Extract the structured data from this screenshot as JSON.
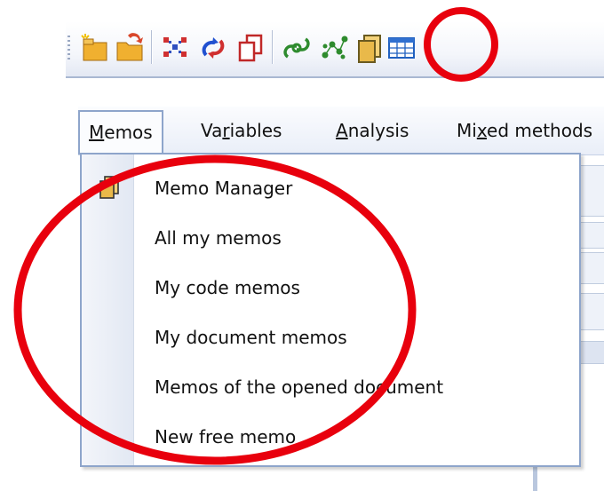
{
  "toolbar": {
    "buttons": [
      {
        "name": "new-project-icon",
        "color": "#e0a22a"
      },
      {
        "name": "open-project-icon",
        "color": "#d9472b"
      },
      {
        "name": "code-relations-icon",
        "color": "#d03030"
      },
      {
        "name": "activate-icon",
        "color": "#2050d0"
      },
      {
        "name": "copy-icon",
        "color": "#c02828"
      },
      {
        "name": "link-icon",
        "color": "#2e8b2e"
      },
      {
        "name": "graph-icon",
        "color": "#2e8b2e"
      },
      {
        "name": "memo-manager-icon",
        "color": "#e0b84a",
        "highlighted": true
      },
      {
        "name": "table-icon",
        "color": "#2060c0"
      }
    ]
  },
  "menubar": {
    "items": [
      {
        "label_access": "M",
        "label_rest": "emos",
        "open": true
      },
      {
        "label_pre": "Va",
        "label_access": "r",
        "label_rest": "iables"
      },
      {
        "label_access": "A",
        "label_rest": "nalysis"
      },
      {
        "label_pre": "Mi",
        "label_access": "x",
        "label_rest": "ed methods"
      }
    ]
  },
  "memos_menu": {
    "items": [
      {
        "label": "Memo Manager",
        "has_icon": true
      },
      {
        "label": "All my memos"
      },
      {
        "label": "My code memos"
      },
      {
        "label": "My document memos"
      },
      {
        "label": "Memos of the opened document"
      },
      {
        "label": "New free memo"
      }
    ]
  },
  "annotation": {
    "color": "#e8000d"
  }
}
